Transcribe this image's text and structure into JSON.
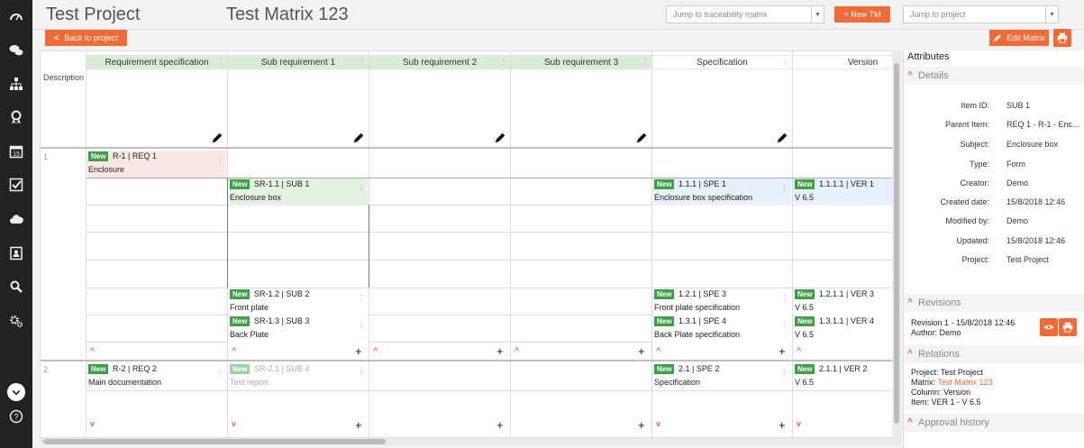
{
  "header": {
    "project_title": "Test Project",
    "matrix_title": "Test Matrix 123",
    "jump_matrix_placeholder": "Jump to traceability matrix",
    "new_tm_label": "+ New TM",
    "jump_project_placeholder": "Jump to project"
  },
  "toolbar": {
    "back_label": "Back to project",
    "edit_matrix_label": "Edit Matrix"
  },
  "grid": {
    "description_label": "Description",
    "columns": [
      "Requirement specification",
      "Sub requirement 1",
      "Sub requirement 2",
      "Sub requirement 3",
      "Specification",
      "Version"
    ],
    "row_numbers": [
      "1",
      "2"
    ],
    "badge": "New",
    "cards": {
      "req1": {
        "code": "R-1 | REQ 1",
        "name": "Enclosure"
      },
      "sub1": {
        "code": "SR-1.1 | SUB 1",
        "name": "Enclosure box"
      },
      "spe1": {
        "code": "1.1.1 | SPE 1",
        "name": "Enclosure box specification"
      },
      "ver1": {
        "code": "1.1.1.1 | VER 1",
        "name": "V 6.5"
      },
      "sub2": {
        "code": "SR-1.2 | SUB 2",
        "name": "Front plate"
      },
      "spe3": {
        "code": "1.2.1 | SPE 3",
        "name": "Front plate specification"
      },
      "ver3": {
        "code": "1.2.1.1 | VER 3",
        "name": "V 6.5"
      },
      "sub3": {
        "code": "SR-1.3 | SUB 3",
        "name": "Back Plate"
      },
      "spe4": {
        "code": "1.3.1 | SPE 4",
        "name": "Back Plate specification"
      },
      "ver4": {
        "code": "1.3.1.1 | VER 4",
        "name": "V 6.5"
      },
      "req2": {
        "code": "R-2 | REQ 2",
        "name": "Main documentation"
      },
      "sub4": {
        "code": "SR-2.1 | SUB 4",
        "name": "Test report"
      },
      "spe2": {
        "code": "2.1 | SPE 2",
        "name": "Specification"
      },
      "ver2": {
        "code": "2.1.1 | VER 2",
        "name": "V 6.5"
      }
    }
  },
  "panel": {
    "title": "Attributes",
    "details": {
      "heading": "Details",
      "rows": [
        {
          "label": "Item ID:",
          "value": "SUB 1"
        },
        {
          "label": "Parent Item:",
          "value": "REQ 1 - R-1 - Enc..."
        },
        {
          "label": "Subject:",
          "value": "Enclosure box"
        },
        {
          "label": "Type:",
          "value": "Form"
        },
        {
          "label": "Creator:",
          "value": "Demo"
        },
        {
          "label": "Created date:",
          "value": "15/8/2018 12:46"
        },
        {
          "label": "Modified by:",
          "value": "Demo"
        },
        {
          "label": "Updated:",
          "value": "15/8/2018 12:46"
        },
        {
          "label": "Project:",
          "value": "Test Project"
        }
      ]
    },
    "revisions": {
      "heading": "Revisions",
      "line1": "Revision 1 - 15/8/2018 12:46",
      "line2": "Author: Demo"
    },
    "relations": {
      "heading": "Relations",
      "project": "Project: Test Project",
      "matrix_label": "Matrix:",
      "matrix_link": "Test Matrix 123",
      "column": "Column: Version",
      "item": "Item: VER 1 - V 6.5"
    },
    "approval": {
      "heading": "Approval history"
    }
  },
  "colors": {
    "accent": "#f26a35",
    "badge_green": "#3f9f48",
    "sidebar": "#222222"
  }
}
